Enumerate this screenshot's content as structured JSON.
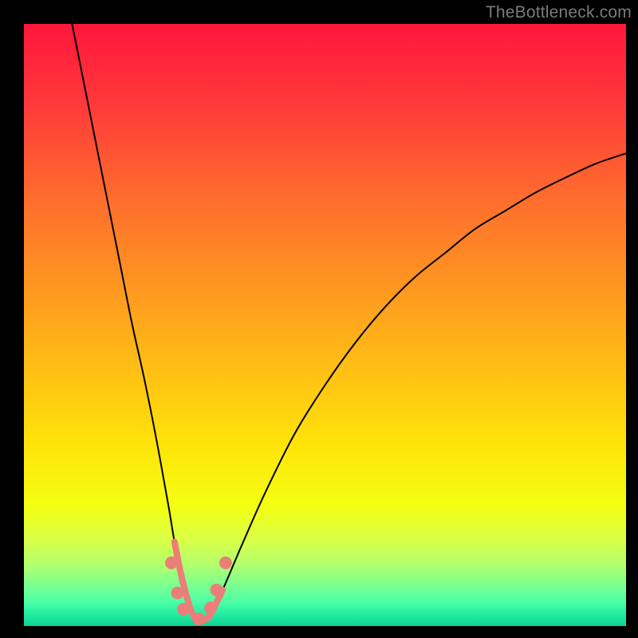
{
  "watermark": "TheBottleneck.com",
  "gradient": {
    "stops": [
      {
        "offset": 0.0,
        "color": "#ff173c"
      },
      {
        "offset": 0.14,
        "color": "#ff3b3a"
      },
      {
        "offset": 0.28,
        "color": "#ff6a2e"
      },
      {
        "offset": 0.42,
        "color": "#ff9222"
      },
      {
        "offset": 0.56,
        "color": "#ffbb16"
      },
      {
        "offset": 0.7,
        "color": "#ffe40a"
      },
      {
        "offset": 0.8,
        "color": "#f4ff11"
      },
      {
        "offset": 0.86,
        "color": "#d7ff4a"
      },
      {
        "offset": 0.9,
        "color": "#b0ff6f"
      },
      {
        "offset": 0.93,
        "color": "#7fff8e"
      },
      {
        "offset": 0.96,
        "color": "#4cffa6"
      },
      {
        "offset": 0.98,
        "color": "#24eda3"
      },
      {
        "offset": 1.0,
        "color": "#10d18f"
      }
    ]
  },
  "chart_data": {
    "type": "line",
    "title": "",
    "xlabel": "",
    "ylabel": "",
    "xlim": [
      0,
      100
    ],
    "ylim": [
      0,
      100
    ],
    "series": [
      {
        "name": "bottleneck-curve",
        "x": [
          8,
          10,
          12,
          14,
          16,
          18,
          20,
          22,
          24,
          25,
          26,
          27,
          28,
          29,
          30,
          31,
          33,
          36,
          40,
          45,
          50,
          55,
          60,
          65,
          70,
          75,
          80,
          85,
          90,
          95,
          100
        ],
        "y": [
          100,
          90,
          80,
          70,
          60,
          50,
          41,
          31,
          20,
          14,
          9,
          5,
          2,
          1,
          1,
          2,
          6,
          13,
          22,
          32,
          40,
          47,
          53,
          58,
          62,
          66,
          69,
          72,
          74.5,
          76.8,
          78.5
        ]
      }
    ],
    "markers": {
      "name": "highlight-points",
      "color": "#ec7e79",
      "points": [
        {
          "x": 24.5,
          "y": 10.5
        },
        {
          "x": 25.5,
          "y": 5.5
        },
        {
          "x": 26.5,
          "y": 2.8
        },
        {
          "x": 29.0,
          "y": 1.2
        },
        {
          "x": 31.0,
          "y": 3.0
        },
        {
          "x": 32.0,
          "y": 6.0
        },
        {
          "x": 33.5,
          "y": 10.5
        }
      ]
    },
    "threshold_band": {
      "y0": 0,
      "y1": 4.5,
      "color_at_top": "#fff97a"
    }
  },
  "colors": {
    "curve": "#000000",
    "marker_fill": "#ec7e79",
    "marker_stroke": "#d06560",
    "watermark": "#7b7b7b",
    "frame": "#000000"
  }
}
